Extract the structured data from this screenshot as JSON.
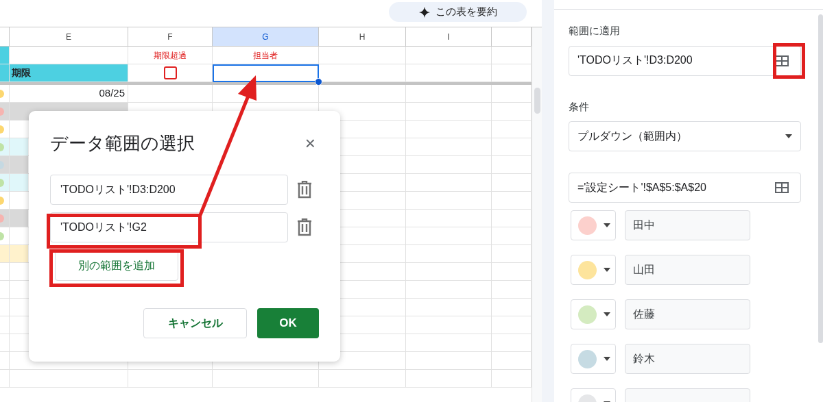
{
  "toolbar": {
    "summarize_label": "この表を要約"
  },
  "sheet": {
    "columns": [
      {
        "label": "E",
        "selected": false
      },
      {
        "label": "F",
        "selected": false
      },
      {
        "label": "G",
        "selected": true
      },
      {
        "label": "H",
        "selected": false
      },
      {
        "label": "I",
        "selected": false
      }
    ],
    "row_1": {
      "F": "期限超過",
      "G": "担当者"
    },
    "row_2": {
      "E": "期限",
      "checkbox": {
        "checked": false
      },
      "G_active": true
    },
    "rows": [
      {
        "kind": "white",
        "color": "#fcd770",
        "text": "08/25"
      },
      {
        "kind": "grey",
        "color": "#f6b4b0"
      },
      {
        "kind": "white",
        "color": "#fcd770"
      },
      {
        "kind": "cyan",
        "color": "#bfe3a6"
      },
      {
        "kind": "grey",
        "color": "#c5d9e2"
      },
      {
        "kind": "cyan",
        "color": "#bfe3a6"
      },
      {
        "kind": "white",
        "color": "#fcd770"
      },
      {
        "kind": "grey",
        "color": "#f6b4b0"
      },
      {
        "kind": "white",
        "color": "#bfe3a6"
      },
      {
        "kind": "yellow"
      }
    ]
  },
  "dialog": {
    "title": "データ範囲の選択",
    "close": "×",
    "ranges": [
      "'TODOリスト'!D3:D200",
      "'TODOリスト'!G2"
    ],
    "add_button": "別の範囲を追加",
    "cancel_button": "キャンセル",
    "ok_button": "OK"
  },
  "panel": {
    "apply_label": "範囲に適用",
    "apply_range": "'TODOリスト'!D3:D200",
    "criteria_label": "条件",
    "criteria": "プルダウン（範囲内）",
    "source_range": "='設定シート'!$A$5:$A$20",
    "options": [
      {
        "color": "#fcd0cc",
        "name": "田中"
      },
      {
        "color": "#fde49c",
        "name": "山田"
      },
      {
        "color": "#d4ebc0",
        "name": "佐藤"
      },
      {
        "color": "#c6dbe3",
        "name": "鈴木"
      },
      {
        "color": "#e6e7e9"
      }
    ]
  }
}
